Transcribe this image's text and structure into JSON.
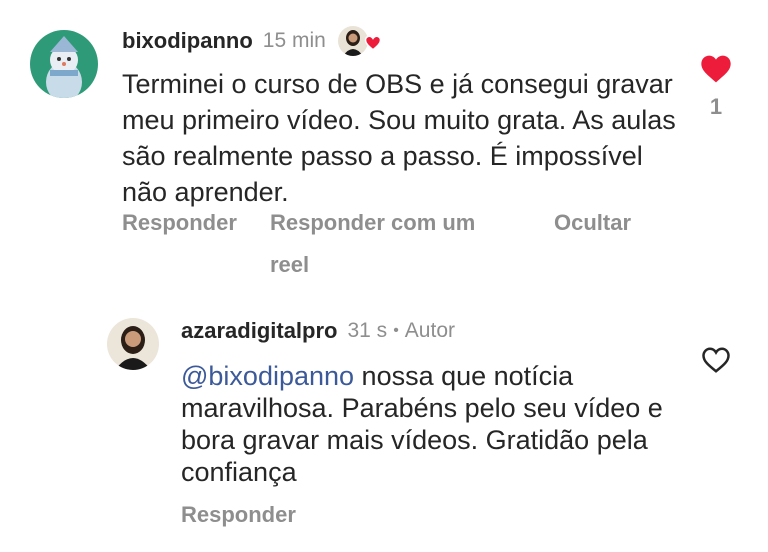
{
  "comment1": {
    "username": "bixodipanno",
    "time": "15 min",
    "text": "Terminei o curso de OBS e já consegui gravar meu primeiro vídeo. Sou muito grata.  As aulas são realmente passo a passo. É impossível não aprender.",
    "actions": {
      "reply": "Responder",
      "reply_reel": "Responder com um reel",
      "hide": "Ocultar"
    },
    "like_count": "1",
    "liked": true
  },
  "comment2": {
    "username": "azaradigitalpro",
    "time": "31 s",
    "separator": "•",
    "author_badge": "Autor",
    "mention": "@bixodipanno",
    "text": " nossa que notícia maravilhosa. Parabéns pelo seu vídeo e bora gravar mais vídeos. Gratidão pela confiança",
    "actions": {
      "reply": "Responder"
    },
    "liked": false
  },
  "colors": {
    "heart": "#ed1c3a",
    "muted": "#8e8e8e",
    "mention": "#3c5a99"
  }
}
